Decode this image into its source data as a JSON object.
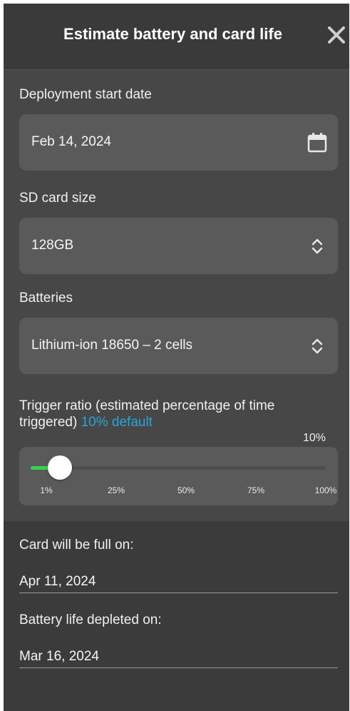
{
  "header": {
    "title": "Estimate battery and card life",
    "close_icon": "close-icon"
  },
  "deployment": {
    "label": "Deployment start date",
    "value": "Feb 14, 2024",
    "icon": "calendar-icon"
  },
  "sd_card": {
    "label": "SD card size",
    "value": "128GB",
    "icon": "chevron-up-down-icon"
  },
  "batteries": {
    "label": "Batteries",
    "value": "Lithium-ion 18650 – 2 cells",
    "icon": "chevron-up-down-icon"
  },
  "trigger": {
    "label": "Trigger ratio (estimated percentage of time triggered)",
    "default_link": "10% default",
    "value_display": "10%",
    "value_fraction": 0.1,
    "ticks": [
      "1%",
      "25%",
      "50%",
      "75%",
      "100%"
    ]
  },
  "results": {
    "card_label": "Card will be full on:",
    "card_value": "Apr 11, 2024",
    "battery_label": "Battery life depleted on:",
    "battery_value": "Mar 16, 2024"
  },
  "colors": {
    "accent_link": "#2aa4d8",
    "slider_fill": "#38d14f"
  }
}
